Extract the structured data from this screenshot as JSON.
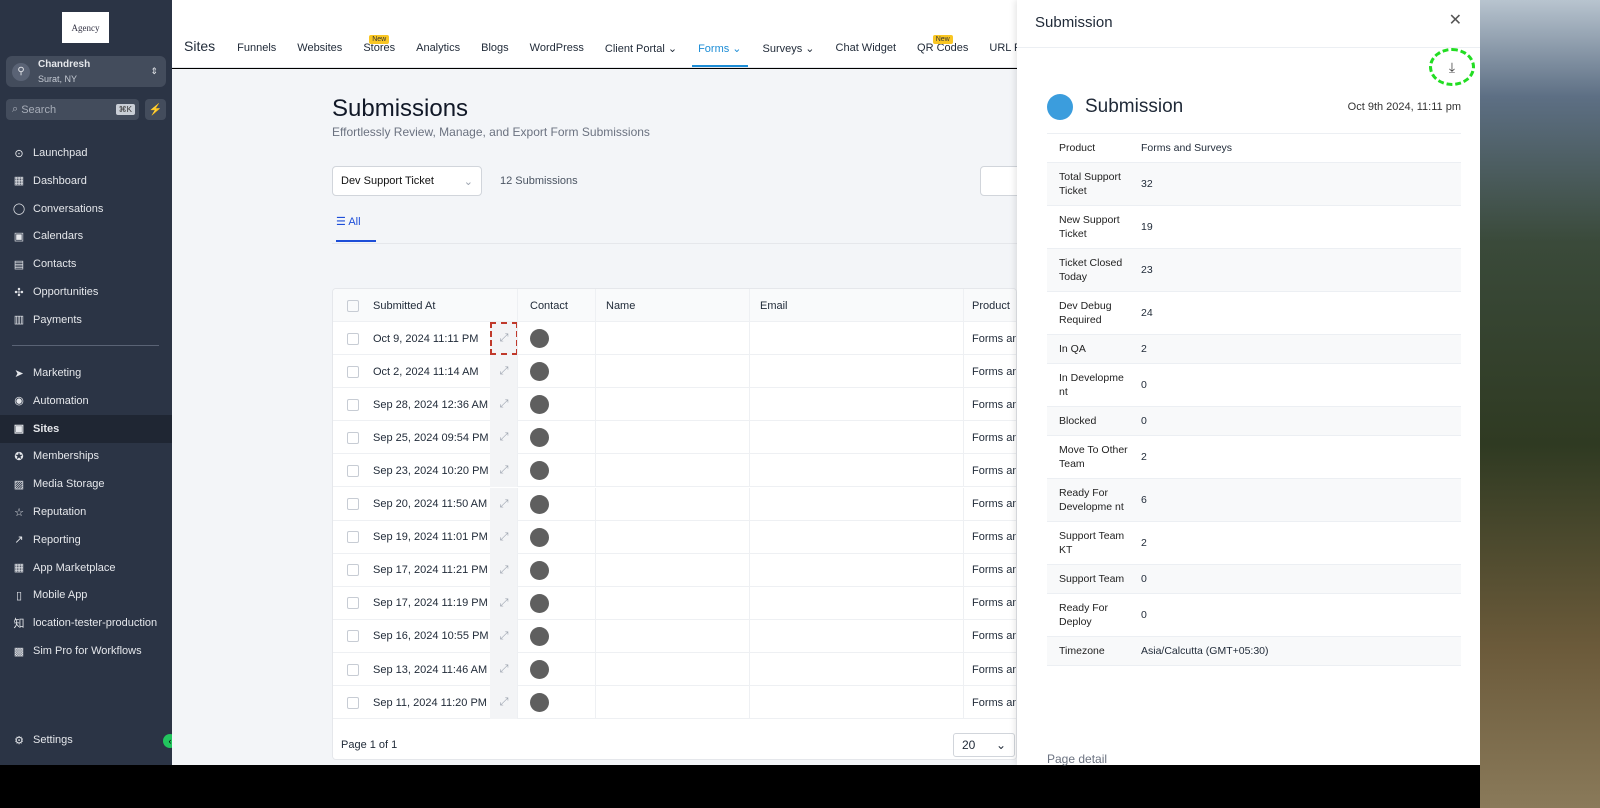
{
  "sidebar": {
    "logo": "Agency",
    "location": {
      "name": "Chandresh",
      "sub": "Surat, NY"
    },
    "search": "Search",
    "shortcut": "⌘K",
    "items": [
      {
        "label": "Launchpad",
        "icon": "rocket-icon",
        "g": "⊙"
      },
      {
        "label": "Dashboard",
        "icon": "dashboard-icon",
        "g": "▦"
      },
      {
        "label": "Conversations",
        "icon": "chat-icon",
        "g": "◯"
      },
      {
        "label": "Calendars",
        "icon": "calendar-icon",
        "g": "▣"
      },
      {
        "label": "Contacts",
        "icon": "contacts-icon",
        "g": "▤"
      },
      {
        "label": "Opportunities",
        "icon": "opportunities-icon",
        "g": "✣"
      },
      {
        "label": "Payments",
        "icon": "payments-icon",
        "g": "▥"
      }
    ],
    "items2": [
      {
        "label": "Marketing",
        "icon": "send-icon",
        "g": "➤"
      },
      {
        "label": "Automation",
        "icon": "automation-icon",
        "g": "◉"
      },
      {
        "label": "Sites",
        "icon": "sites-icon",
        "g": "▣",
        "active": true
      },
      {
        "label": "Memberships",
        "icon": "membership-icon",
        "g": "✪"
      },
      {
        "label": "Media Storage",
        "icon": "image-icon",
        "g": "▨"
      },
      {
        "label": "Reputation",
        "icon": "star-icon",
        "g": "☆"
      },
      {
        "label": "Reporting",
        "icon": "trend-icon",
        "g": "↗"
      },
      {
        "label": "App Marketplace",
        "icon": "apps-icon",
        "g": "▦"
      },
      {
        "label": "Mobile App",
        "icon": "mobile-icon",
        "g": "▯"
      },
      {
        "label": "location-tester-production",
        "icon": "zhihu-icon",
        "g": "知"
      },
      {
        "label": "Sim Pro for Workflows",
        "icon": "sim-icon",
        "g": "▩"
      }
    ],
    "settings": "Settings"
  },
  "topnav": {
    "title": "Sites",
    "tabs": [
      {
        "label": "Funnels"
      },
      {
        "label": "Websites"
      },
      {
        "label": "Stores",
        "badge": "New"
      },
      {
        "label": "Analytics"
      },
      {
        "label": "Blogs"
      },
      {
        "label": "WordPress"
      },
      {
        "label": "Client Portal ⌄"
      },
      {
        "label": "Forms ⌄",
        "active": true
      },
      {
        "label": "Surveys ⌄"
      },
      {
        "label": "Chat Widget"
      },
      {
        "label": "QR Codes",
        "badge": "New"
      },
      {
        "label": "URL Redirects"
      }
    ]
  },
  "main": {
    "title": "Submissions",
    "subtitle": "Effortlessly Review, Manage, and Export Form Submissions",
    "form_select": "Dev Support Ticket",
    "count": "12 Submissions",
    "tab_all": "All",
    "columns": [
      "Submitted At",
      "Contact",
      "Name",
      "Email",
      "Product"
    ],
    "rows": [
      "Oct 9, 2024 11:11 PM",
      "Oct 2, 2024 11:14 AM",
      "Sep 28, 2024 12:36 AM",
      "Sep 25, 2024 09:54 PM",
      "Sep 23, 2024 10:20 PM",
      "Sep 20, 2024 11:50 AM",
      "Sep 19, 2024 11:01 PM",
      "Sep 17, 2024 11:21 PM",
      "Sep 17, 2024 11:19 PM",
      "Sep 16, 2024 10:55 PM",
      "Sep 13, 2024 11:46 AM",
      "Sep 11, 2024 11:20 PM"
    ],
    "product_value": "Forms and Surveys",
    "page": "Page 1 of 1",
    "per_page": "20"
  },
  "drawer": {
    "title": "Submission",
    "name": "Submission",
    "date": "Oct 9th 2024, 11:11 pm",
    "page_detail": "Page detail",
    "fields": [
      [
        "Product",
        "Forms and Surveys"
      ],
      [
        "Total Support Ticket",
        "32"
      ],
      [
        "New Support Ticket",
        "19"
      ],
      [
        "Ticket Closed Today",
        "23"
      ],
      [
        "Dev Debug Required",
        "24"
      ],
      [
        "In QA",
        "2"
      ],
      [
        "In Developme nt",
        "0"
      ],
      [
        "Blocked",
        "0"
      ],
      [
        "Move To Other Team",
        "2"
      ],
      [
        "Ready For Developme nt",
        "6"
      ],
      [
        "Support Team KT",
        "2"
      ],
      [
        "Support Team",
        "0"
      ],
      [
        "Ready For Deploy",
        "0"
      ],
      [
        "Timezone",
        "Asia/Calcutta (GMT+05:30)"
      ]
    ],
    "dot_color": "#3b9ddd"
  }
}
